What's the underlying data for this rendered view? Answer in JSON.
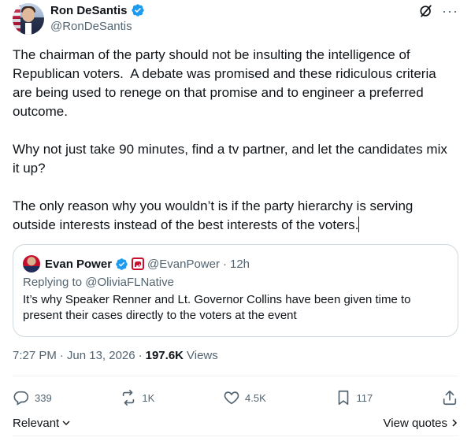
{
  "author": {
    "display_name": "Ron DeSantis",
    "handle": "@RonDeSantis"
  },
  "tweet": {
    "paragraphs": [
      "The chairman of the party should not be insulting the intelligence of Republican voters.  A debate was promised and these ridiculous criteria are being used to renege on that promise and to engineer a preferred outcome.",
      "Why not just take 90 minutes, find a tv partner, and let the candidates mix it up?",
      "The only reason why you wouldn’t is if the party hierarchy is serving outside interests instead of the best interests of the voters."
    ]
  },
  "quote": {
    "display_name": "Evan Power",
    "handle": "@EvanPower",
    "separator": "·",
    "time": "12h",
    "replying_prefix": "Replying to ",
    "replying_to": "@OliviaFLNative",
    "text": "It’s why Speaker Renner and Lt. Governor Collins have been given time to present their cases directly to the voters at the event",
    "party_badge_glyph": "🐘"
  },
  "meta": {
    "time": "7:27 PM",
    "separator1": "·",
    "date": "Jun 13, 2026",
    "separator2": "·",
    "views_count": "197.6K",
    "views_label": "Views"
  },
  "actions": {
    "replies": "339",
    "reposts": "1K",
    "likes": "4.5K",
    "bookmarks": "117"
  },
  "footer": {
    "sort_label": "Relevant",
    "view_quotes_label": "View quotes"
  },
  "icons": {
    "verified": "verified-badge-icon",
    "grok": "grok-icon",
    "more": "more-icon",
    "reply": "reply-icon",
    "repost": "repost-icon",
    "like": "heart-icon",
    "bookmark": "bookmark-icon",
    "share": "share-icon"
  },
  "colors": {
    "verified_blue": "#1d9bf0",
    "muted_text": "#536471",
    "border": "#cfd9de",
    "party_red": "#c8102e"
  }
}
